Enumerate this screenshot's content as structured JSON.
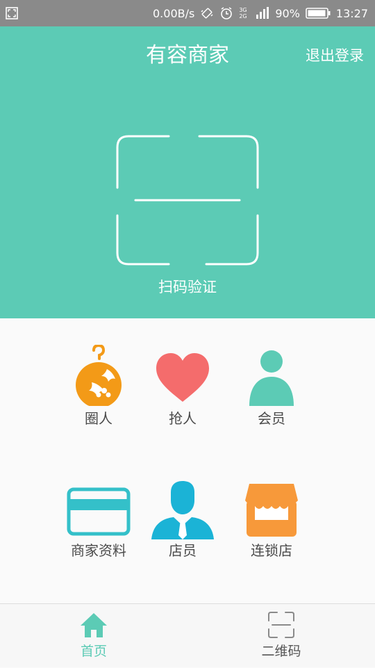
{
  "status_bar": {
    "speed": "0.00B/s",
    "network": "3G 2G",
    "battery": "90%",
    "time": "13:27",
    "icons": [
      "screenshot-icon",
      "vibrate-icon",
      "alarm-icon",
      "signal-icon",
      "battery-icon"
    ]
  },
  "header": {
    "title": "有容商家",
    "logout_label": "退出登录",
    "scan_label": "扫码验证",
    "background_color": "#5ccbb5"
  },
  "grid": {
    "items": [
      {
        "label": "圈人",
        "icon": "ornament-icon",
        "color": "#f39a17"
      },
      {
        "label": "抢人",
        "icon": "heart-icon",
        "color": "#f46c6c"
      },
      {
        "label": "会员",
        "icon": "member-icon",
        "color": "#5ccbb5"
      },
      {
        "label": "商家资料",
        "icon": "card-icon",
        "color": "#34c0c9"
      },
      {
        "label": "店员",
        "icon": "clerk-icon",
        "color": "#1bb3d6"
      },
      {
        "label": "连锁店",
        "icon": "store-icon",
        "color": "#f7993a"
      }
    ]
  },
  "tabbar": {
    "tabs": [
      {
        "label": "首页",
        "icon": "home-icon",
        "active": true,
        "color": "#5ccbb5"
      },
      {
        "label": "二维码",
        "icon": "qrcode-icon",
        "active": false,
        "color": "#555555"
      }
    ]
  }
}
